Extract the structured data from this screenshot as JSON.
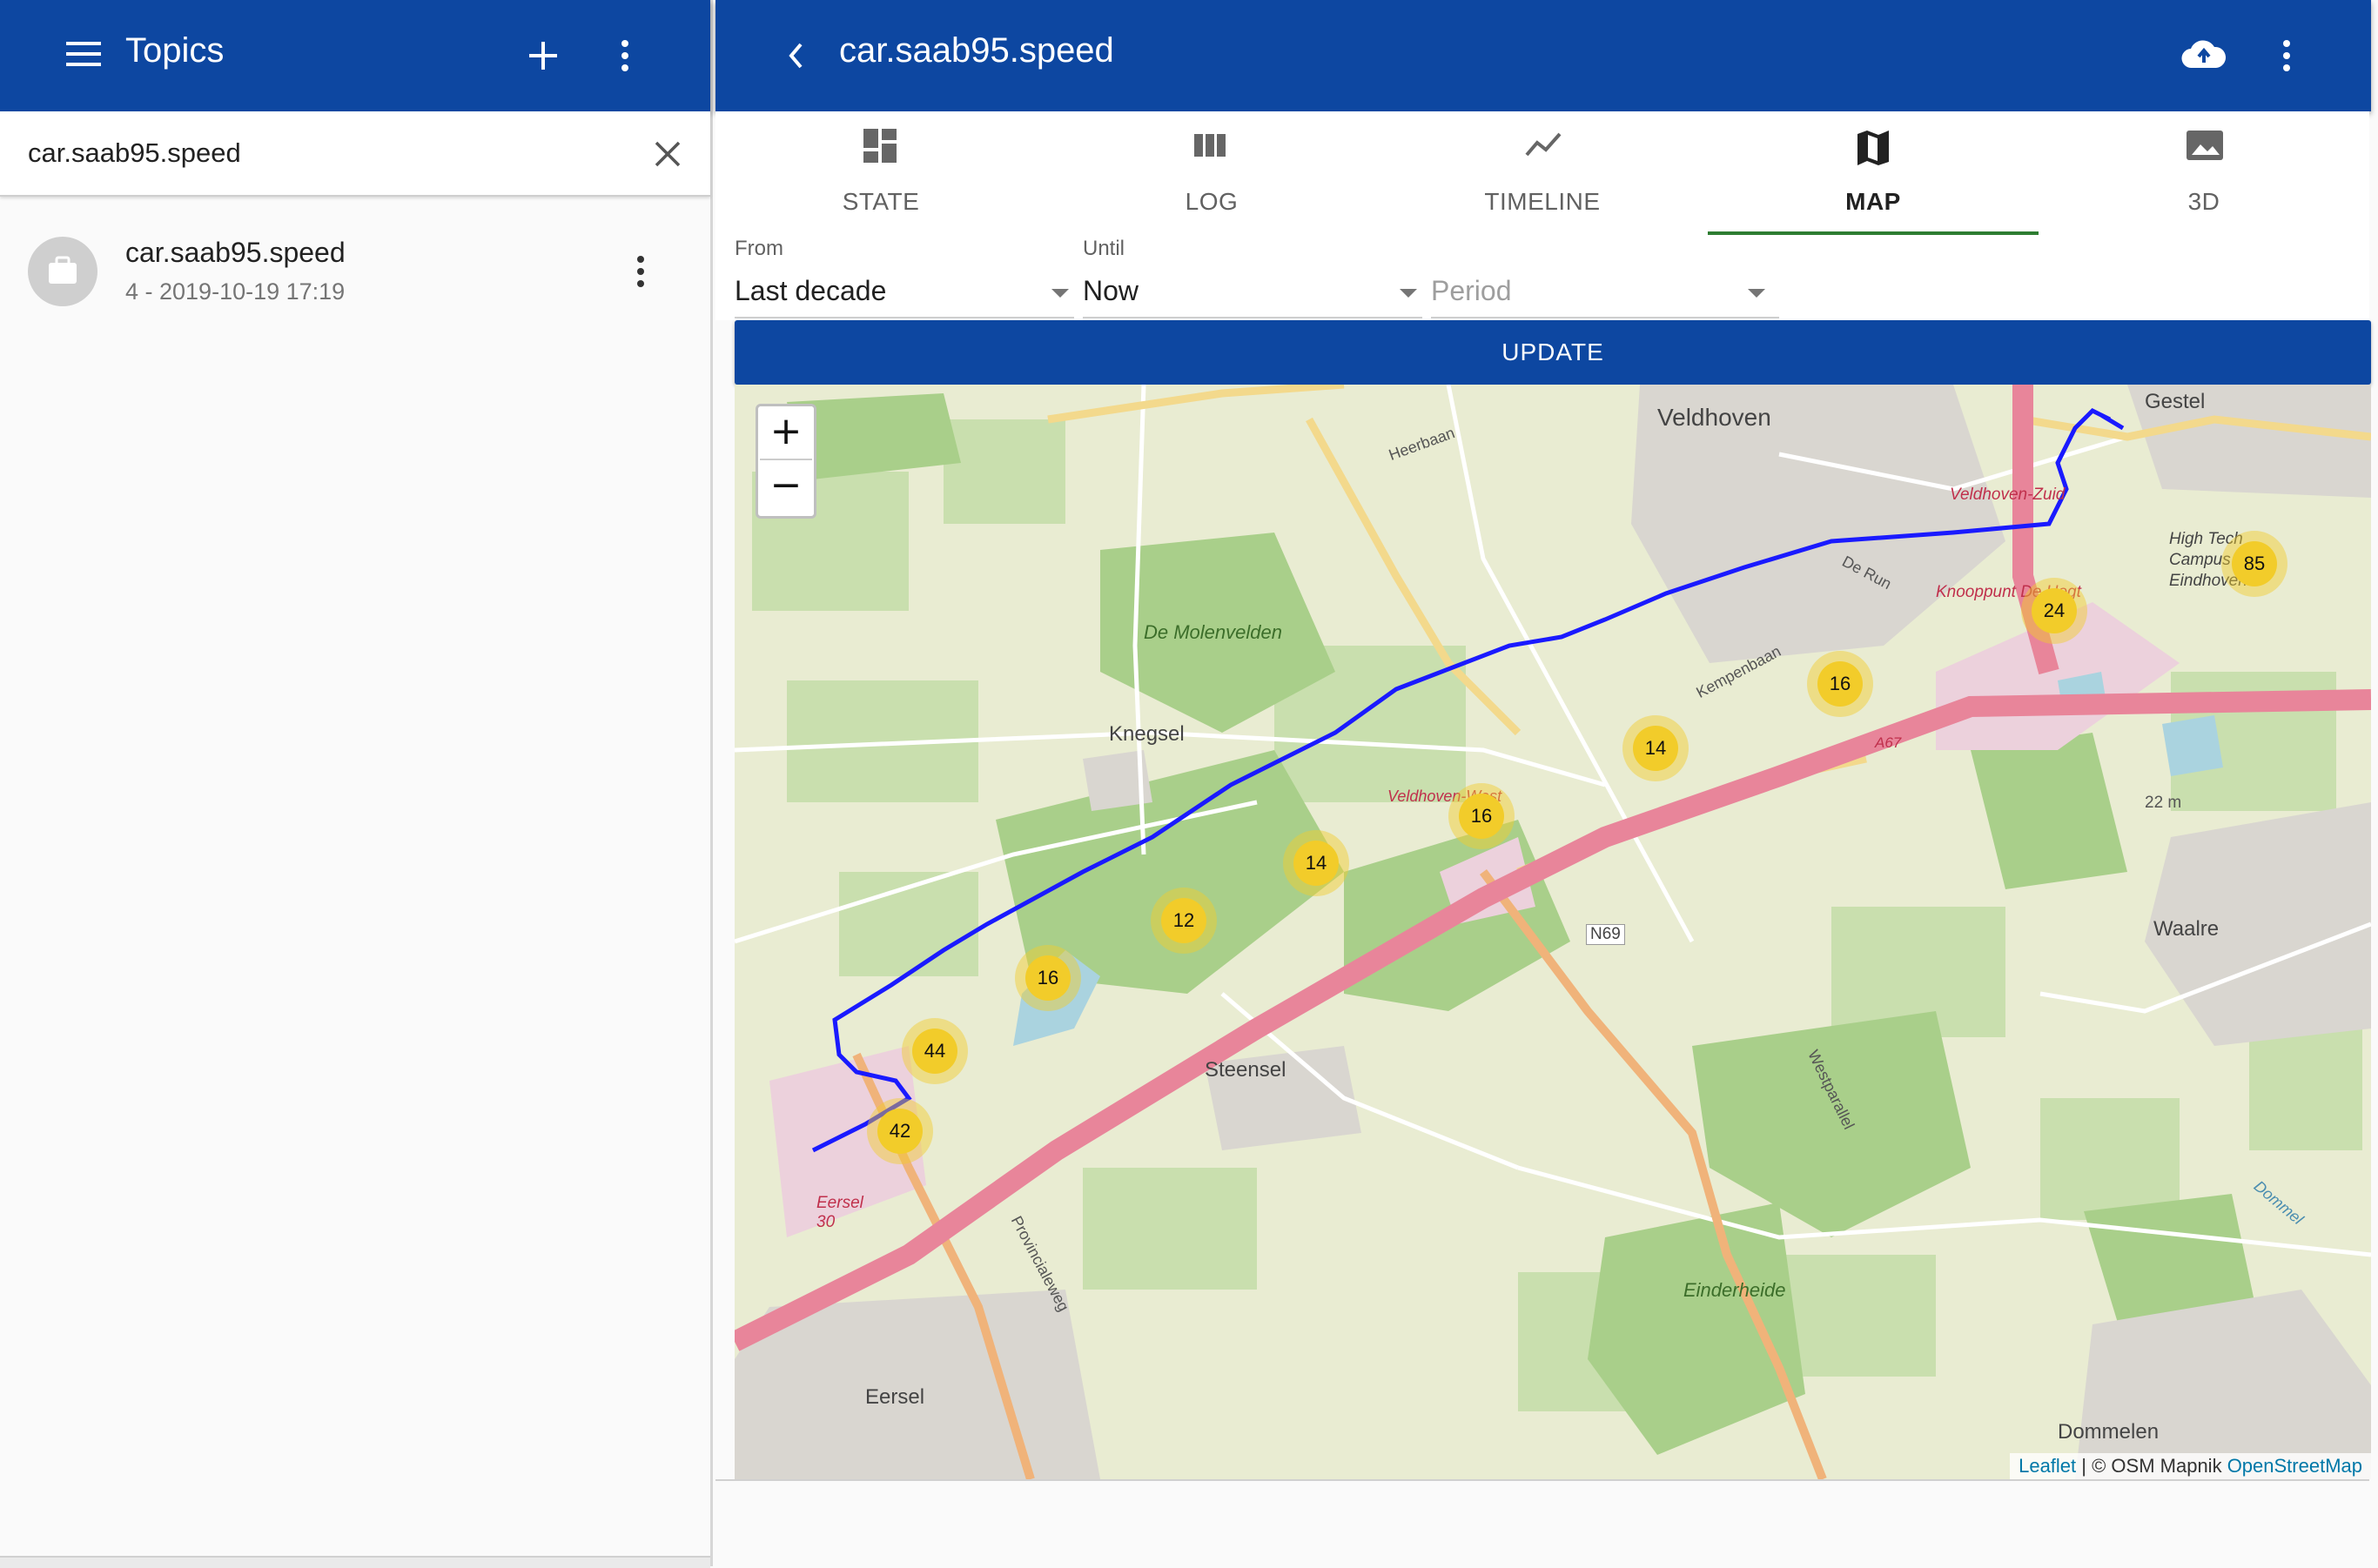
{
  "left_panel": {
    "title": "Topics",
    "search_value": "car.saab95.speed",
    "items": [
      {
        "title": "car.saab95.speed",
        "subtitle": "4 - 2019-10-19 17:19"
      }
    ]
  },
  "right_panel": {
    "title": "car.saab95.speed",
    "tabs": [
      {
        "label": "STATE",
        "icon": "dashboard-icon"
      },
      {
        "label": "LOG",
        "icon": "columns-icon"
      },
      {
        "label": "TIMELINE",
        "icon": "timeline-icon"
      },
      {
        "label": "MAP",
        "icon": "map-icon",
        "active": true
      },
      {
        "label": "3D",
        "icon": "image-icon"
      }
    ],
    "filters": {
      "from_label": "From",
      "from_value": "Last decade",
      "until_label": "Until",
      "until_value": "Now",
      "period_placeholder": "Period"
    },
    "update_label": "UPDATE"
  },
  "map": {
    "place_labels": [
      "Veldhoven",
      "Gestel",
      "Knegsel",
      "Steensel",
      "Waalre",
      "Eersel",
      "Dommelen",
      "Einderheide",
      "De Molenvelden",
      "Kempenbaan",
      "De Run",
      "Heerbaan",
      "Knooppunt De Hogt",
      "Veldhoven-Zuid",
      "High Tech Campus Eindhoven",
      "Provincialeweg",
      "Westparallel",
      "N69",
      "A67",
      "22 m",
      "Dommel",
      "Eersel 30",
      "Veldhoven-West"
    ],
    "clusters": [
      85,
      24,
      16,
      14,
      16,
      14,
      12,
      16,
      44,
      42
    ],
    "zoom_in": "+",
    "zoom_out": "−",
    "attribution": {
      "leaflet": "Leaflet",
      "sep": " | © OSM Mapnik ",
      "osm": "OpenStreetMap"
    },
    "colors": {
      "route": "#1a1aff",
      "highway": "#e8859a",
      "cluster": "#f2cc2a"
    }
  }
}
